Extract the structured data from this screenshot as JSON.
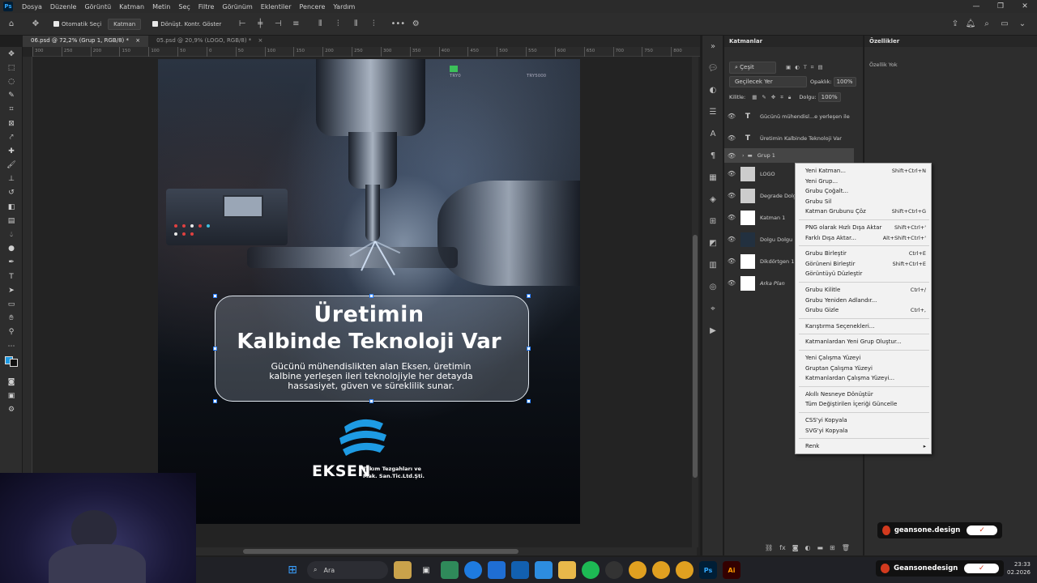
{
  "menubar": {
    "app_icon": "Ps",
    "items": [
      "Dosya",
      "Düzenle",
      "Görüntü",
      "Katman",
      "Metin",
      "Seç",
      "Filtre",
      "Görünüm",
      "Eklentiler",
      "Pencere",
      "Yardım"
    ]
  },
  "options": {
    "auto_select_label": "Otomatik Seçi",
    "auto_select_target": "Katman",
    "transform_controls_label": "Dönüşt. Kontr. Göster"
  },
  "tabs": [
    {
      "label": "06.psd @ 72,2% (Grup 1, RGB/8) *",
      "active": true
    },
    {
      "label": "05.psd @ 20,9% (LOGO, RGB/8) *",
      "active": false
    }
  ],
  "ruler": [
    "300",
    "250",
    "200",
    "150",
    "100",
    "50",
    "0",
    "50",
    "100",
    "150",
    "200",
    "250",
    "300",
    "350",
    "400",
    "450",
    "500",
    "550",
    "600",
    "650",
    "700",
    "750",
    "800"
  ],
  "document": {
    "top_label_left": "TRY0",
    "top_label_right": "TRY5000",
    "headline_line1": "Üretimin",
    "headline_line2": "Kalbinde Teknoloji Var",
    "subtitle_lines": [
      "Gücünü mühendislikten alan Eksen, üretimin",
      "kalbine yerleşen ileri teknolojiyle her detayda",
      "hassasiyet, güven ve süreklilik sunar."
    ],
    "logo_word": "EKSEN",
    "logo_tagline_1": "Takım Tezgahları ve",
    "logo_tagline_2": "Mak. San.Tic.Ltd.Şti.",
    "colors": {
      "logo_blue": "#1e9be3",
      "box_border": "#dfe6ee"
    }
  },
  "layers_panel": {
    "title": "Katmanlar",
    "filter_label": "Çeşit",
    "blend_mode": "Geçilecek Yer",
    "opacity_label": "Opaklık:",
    "opacity_value": "100%",
    "lock_label": "Kilitle:",
    "fill_label": "Dolgu:",
    "fill_value": "100%",
    "layers": [
      {
        "name": "Gücünü mühendisl...e yerleşen ile",
        "kind": "text"
      },
      {
        "name": "Üretimin Kalbinde Teknoloji Var",
        "kind": "text"
      },
      {
        "name": "Grup 1",
        "kind": "group"
      },
      {
        "name": "LOGO",
        "kind": "image"
      },
      {
        "name": "Degrade Dolg",
        "kind": "image"
      },
      {
        "name": "Katman 1",
        "kind": "image"
      },
      {
        "name": "Dolgu Dolgu",
        "kind": "image"
      },
      {
        "name": "Dikdörtgen 1",
        "kind": "image"
      },
      {
        "name": "Arka Plan",
        "kind": "image"
      }
    ]
  },
  "properties_panel": {
    "title": "Özellikler",
    "empty_label": "Özellik Yok"
  },
  "context_menu": {
    "groups": [
      [
        {
          "label": "Yeni Katman...",
          "shortcut": "Shift+Ctrl+N"
        },
        {
          "label": "Yeni Grup...",
          "shortcut": ""
        },
        {
          "label": "Grubu Çoğalt...",
          "shortcut": ""
        },
        {
          "label": "Grubu Sil",
          "shortcut": ""
        },
        {
          "label": "Katman Grubunu Çöz",
          "shortcut": "Shift+Ctrl+G"
        }
      ],
      [
        {
          "label": "PNG olarak Hızlı Dışa Aktar",
          "shortcut": "Shift+Ctrl+'"
        },
        {
          "label": "Farklı Dışa Aktar...",
          "shortcut": "Alt+Shift+Ctrl+'"
        }
      ],
      [
        {
          "label": "Grubu Birleştir",
          "shortcut": "Ctrl+E"
        },
        {
          "label": "Görüneni Birleştir",
          "shortcut": "Shift+Ctrl+E"
        },
        {
          "label": "Görüntüyü Düzleştir",
          "shortcut": ""
        }
      ],
      [
        {
          "label": "Grubu Kilitle",
          "shortcut": "Ctrl+/"
        },
        {
          "label": "Grubu Yeniden Adlandır...",
          "shortcut": ""
        },
        {
          "label": "Grubu Gizle",
          "shortcut": "Ctrl+,"
        }
      ],
      [
        {
          "label": "Karıştırma Seçenekleri...",
          "shortcut": ""
        }
      ],
      [
        {
          "label": "Katmanlardan Yeni Grup Oluştur...",
          "shortcut": ""
        }
      ],
      [
        {
          "label": "Yeni Çalışma Yüzeyi",
          "shortcut": ""
        },
        {
          "label": "Gruptan Çalışma Yüzeyi",
          "shortcut": ""
        },
        {
          "label": "Katmanlardan Çalışma Yüzeyi...",
          "shortcut": ""
        }
      ],
      [
        {
          "label": "Akıllı Nesneye Dönüştür",
          "shortcut": ""
        },
        {
          "label": "Tüm Değiştirilen İçeriği Güncelle",
          "shortcut": ""
        }
      ],
      [
        {
          "label": "CSS'yi Kopyala",
          "shortcut": ""
        },
        {
          "label": "SVG'yi Kopyala",
          "shortcut": ""
        }
      ],
      [
        {
          "label": "Renk",
          "shortcut": "▸"
        }
      ]
    ]
  },
  "taskbar": {
    "search_placeholder": "Ara",
    "time": "23:33",
    "date": "02.2026"
  },
  "overlays": {
    "badge_top": "geansone.design",
    "badge_bottom": "Geansonedesign"
  }
}
